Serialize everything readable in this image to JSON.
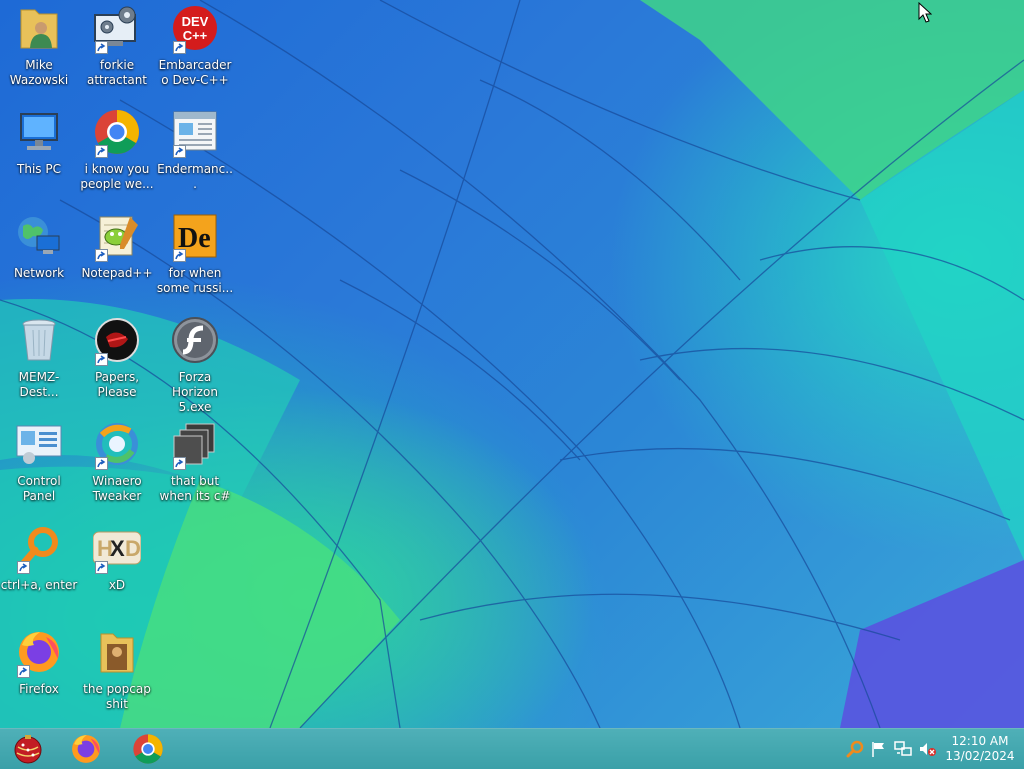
{
  "desktop": {
    "icons": [
      {
        "label": "Mike Wazowski"
      },
      {
        "label": "forkie attractant"
      },
      {
        "label": "Embarcadero Dev-C++"
      },
      {
        "label": "This PC"
      },
      {
        "label": "i know you people we..."
      },
      {
        "label": "Endermanc..."
      },
      {
        "label": "Network"
      },
      {
        "label": "Notepad++"
      },
      {
        "label": "for when some russi..."
      },
      {
        "label": "MEMZ-Dest..."
      },
      {
        "label": "Papers, Please"
      },
      {
        "label": "Forza Horizon 5.exe"
      },
      {
        "label": "Control Panel"
      },
      {
        "label": "Winaero Tweaker"
      },
      {
        "label": "that but when its c#"
      },
      {
        "label": "ctrl+a, enter"
      },
      {
        "label": "xD"
      },
      {
        "label": "Firefox"
      },
      {
        "label": "the popcap shit"
      }
    ],
    "devcpp_logo_text": "DEV C++"
  },
  "taskbar": {
    "pinned": [
      {
        "icon": "start-orb-icon"
      },
      {
        "icon": "firefox-icon"
      },
      {
        "icon": "chrome-icon"
      }
    ],
    "tray": {
      "icons": [
        "search-icon",
        "flag-icon",
        "network-icon",
        "volume-muted-icon"
      ]
    },
    "clock": {
      "time": "12:10 AM",
      "date": "13/02/2024"
    }
  },
  "colors": {
    "taskbar": "#3fa7ae",
    "wallpaper_blue": "#2a78d8",
    "wallpaper_green": "#3fe08c",
    "wallpaper_teal": "#26d7c4"
  }
}
